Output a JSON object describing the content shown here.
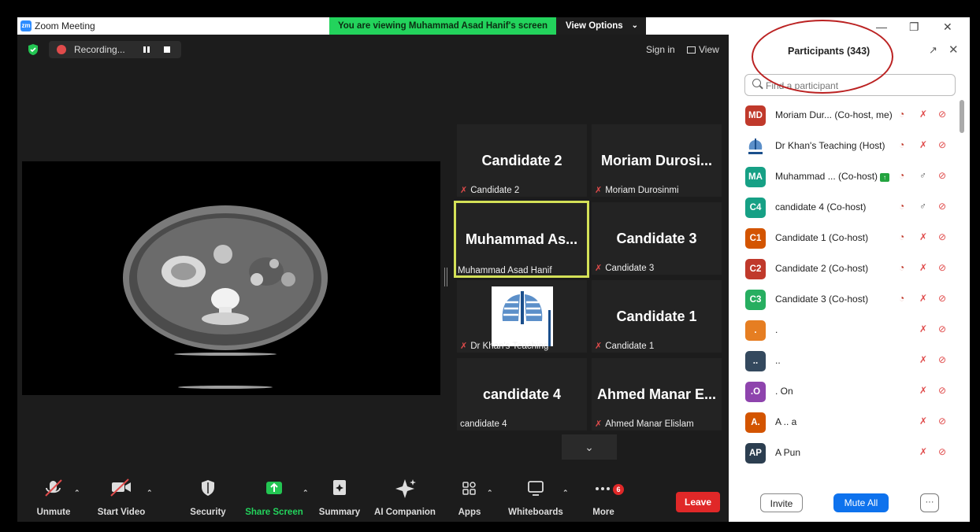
{
  "window": {
    "title": "Zoom Meeting",
    "logo": "zm"
  },
  "banner": {
    "text": "You are viewing Muhammad Asad Hanif's screen",
    "view_options": "View Options"
  },
  "topbar": {
    "recording_label": "Recording...",
    "sign_in": "Sign in",
    "view": "View"
  },
  "gallery": [
    {
      "big": "Candidate 2",
      "name": "Candidate 2",
      "muted": true
    },
    {
      "big": "Moriam  Durosi...",
      "name": "Moriam Durosinmi",
      "muted": true
    },
    {
      "big": "Muhammad  As...",
      "name": "Muhammad Asad Hanif",
      "muted": false,
      "active": true
    },
    {
      "big": "Candidate 3",
      "name": "Candidate 3",
      "muted": true
    },
    {
      "big": "",
      "name": "Dr Khan's Teaching",
      "muted": true,
      "image": "dkt-logo"
    },
    {
      "big": "Candidate 1",
      "name": "Candidate 1",
      "muted": true
    },
    {
      "big": "candidate 4",
      "name": "candidate 4",
      "muted": false
    },
    {
      "big": "Ahmed  Manar  E...",
      "name": "Ahmed Manar Elislam",
      "muted": true
    }
  ],
  "toolbar": {
    "unmute": "Unmute",
    "start_video": "Start Video",
    "security": "Security",
    "share_screen": "Share Screen",
    "summary": "Summary",
    "ai_companion": "AI Companion",
    "apps": "Apps",
    "whiteboards": "Whiteboards",
    "more": "More",
    "more_badge": "6",
    "leave": "Leave"
  },
  "panel": {
    "title": "Participants (343)",
    "search_placeholder": "Find a participant",
    "invite": "Invite",
    "mute_all": "Mute All",
    "more": "···",
    "participants": [
      {
        "initials": "MD",
        "color": "#c0392b",
        "name": "Moriam Dur...  (Co-host, me)",
        "rec": true,
        "mic": "muted",
        "video": "off"
      },
      {
        "initials": "",
        "color": "#ffffff",
        "name": "Dr Khan's Teaching (Host)",
        "rec": true,
        "mic": "muted",
        "video": "off",
        "image": "dkt-logo"
      },
      {
        "initials": "MA",
        "color": "#16a085",
        "name": "Muhammad ... (Co-host)",
        "rec": true,
        "mic": "on",
        "video": "off",
        "sharing": true
      },
      {
        "initials": "C4",
        "color": "#16a085",
        "name": "candidate 4 (Co-host)",
        "rec": true,
        "mic": "on",
        "video": "off"
      },
      {
        "initials": "C1",
        "color": "#d35400",
        "name": "Candidate 1 (Co-host)",
        "rec": true,
        "mic": "muted",
        "video": "off"
      },
      {
        "initials": "C2",
        "color": "#c0392b",
        "name": "Candidate 2 (Co-host)",
        "rec": true,
        "mic": "muted",
        "video": "off"
      },
      {
        "initials": "C3",
        "color": "#27ae60",
        "name": "Candidate 3 (Co-host)",
        "rec": true,
        "mic": "muted",
        "video": "off"
      },
      {
        "initials": ".",
        "color": "#e67e22",
        "name": ".",
        "rec": false,
        "mic": "muted",
        "video": "off"
      },
      {
        "initials": "..",
        "color": "#34495e",
        "name": "..",
        "rec": false,
        "mic": "muted",
        "video": "off"
      },
      {
        "initials": ".O",
        "color": "#8e44ad",
        "name": ". On",
        "rec": false,
        "mic": "muted",
        "video": "off"
      },
      {
        "initials": "A.",
        "color": "#d35400",
        "name": "A .. a",
        "rec": false,
        "mic": "muted",
        "video": "off"
      },
      {
        "initials": "AP",
        "color": "#2c3e50",
        "name": "A Pun",
        "rec": false,
        "mic": "muted",
        "video": "off"
      }
    ]
  },
  "colors": {
    "accent": "#0e72ed",
    "banner": "#23d35c",
    "leave": "#e02828",
    "muted": "#e04b4b",
    "active_speaker": "#d4e157"
  }
}
